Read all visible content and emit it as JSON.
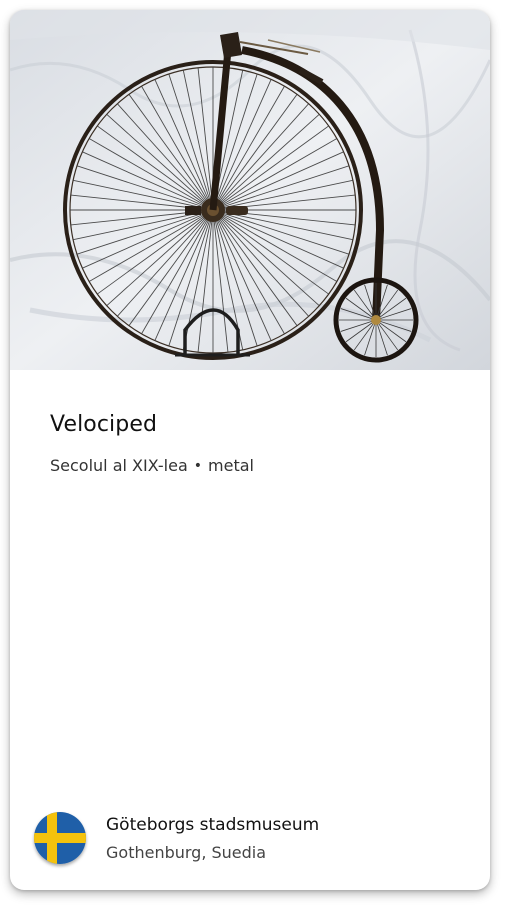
{
  "artwork": {
    "title": "Velociped",
    "period": "Secolul al XIX-lea",
    "separator": "•",
    "medium": "metal"
  },
  "museum": {
    "name": "Göteborgs stadsmuseum",
    "location": "Gothenburg, Suedia",
    "flag": "sweden-flag-icon"
  },
  "colors": {
    "flag_blue": "#1f5fa8",
    "flag_yellow": "#f4c20d",
    "photo_bg": "#e9ebee",
    "frame": "#2a2018"
  }
}
